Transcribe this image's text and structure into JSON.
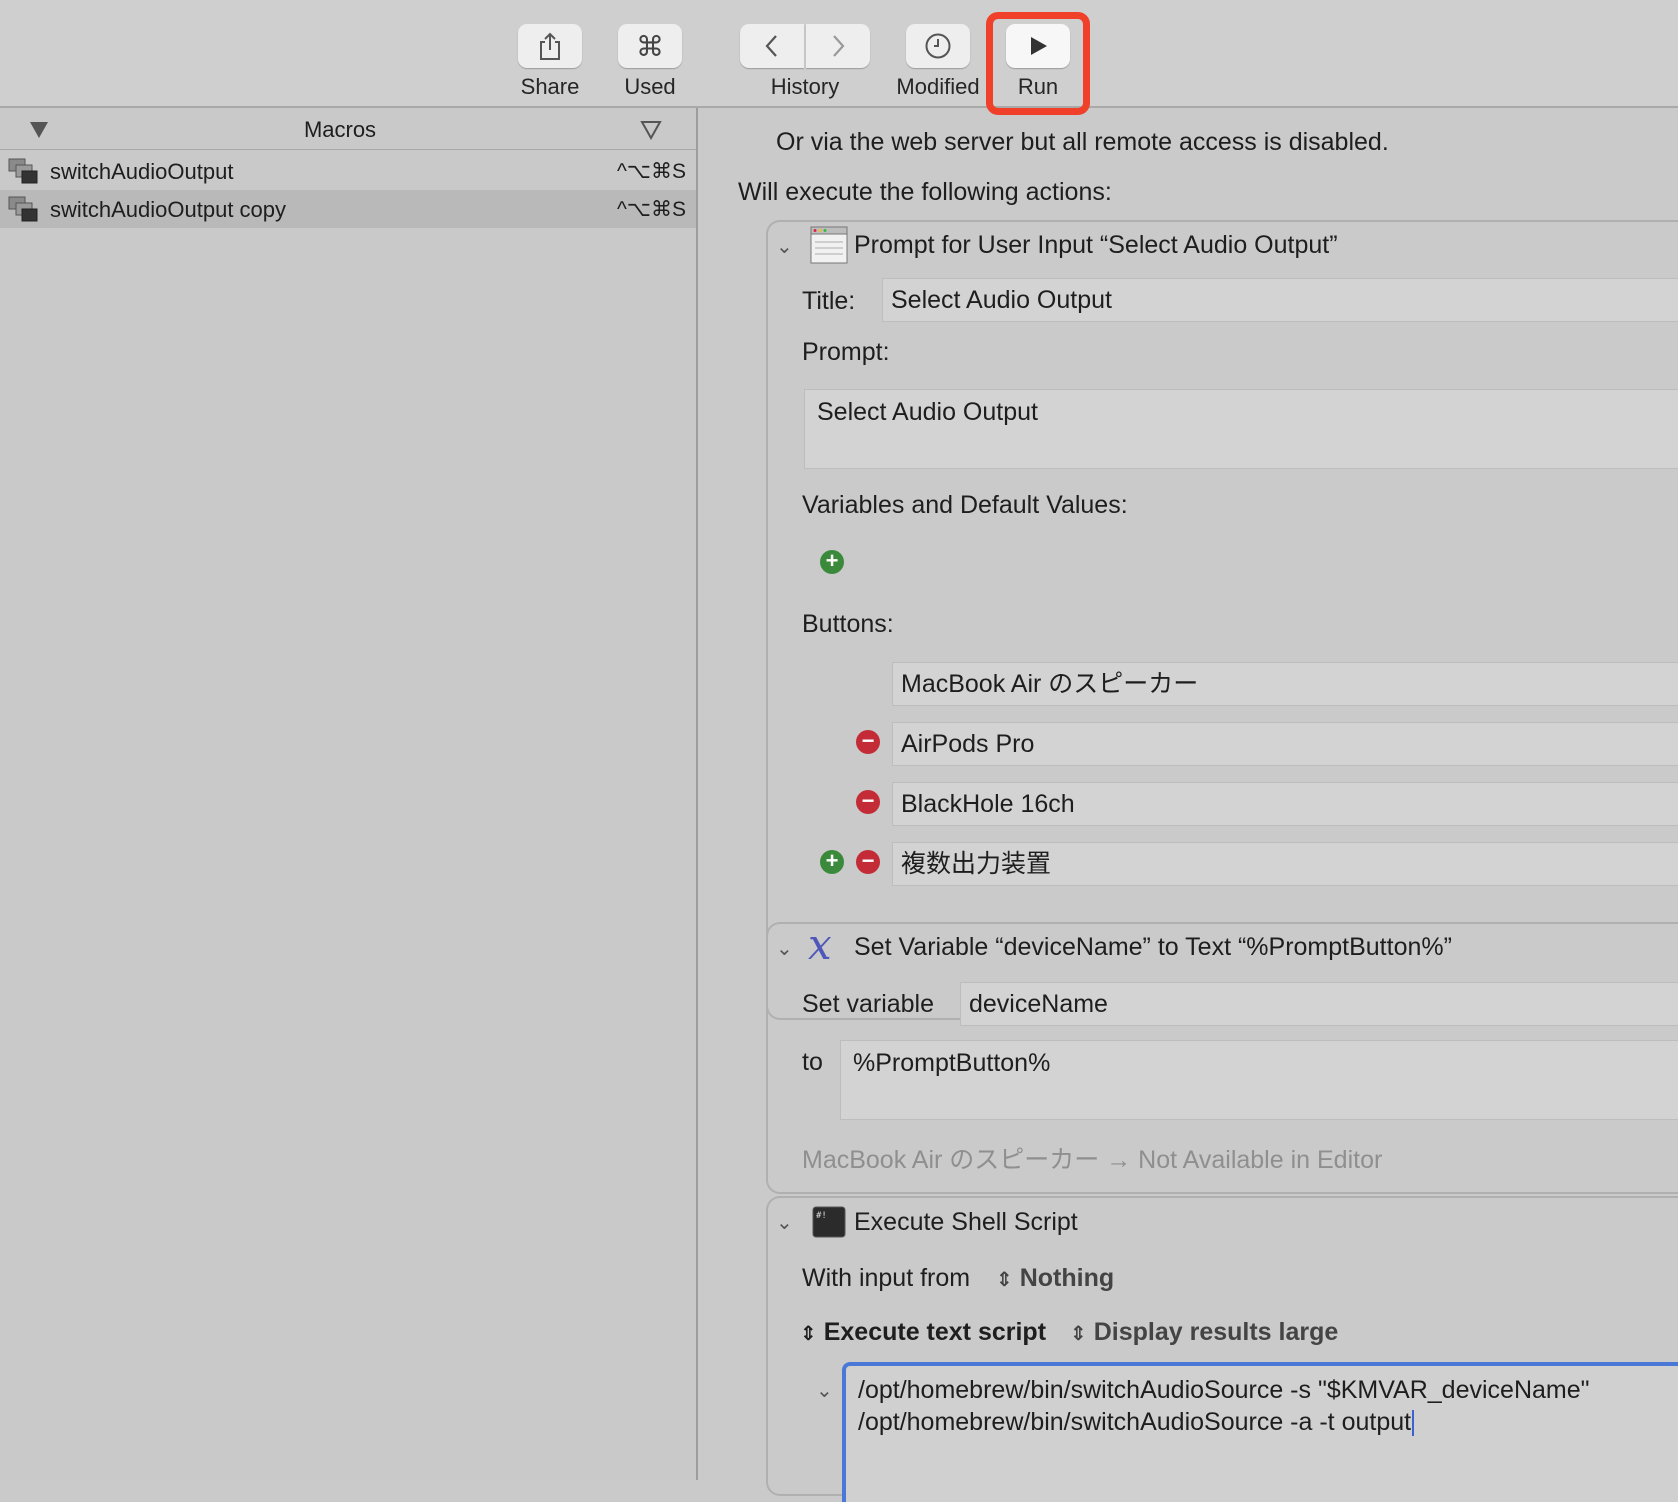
{
  "toolbar": {
    "share": "Share",
    "used": "Used",
    "history": "History",
    "modified": "Modified",
    "run": "Run"
  },
  "sidebar": {
    "header": "Macros",
    "macros": [
      {
        "name": "switchAudioOutput",
        "shortcut": "^⌥⌘S"
      },
      {
        "name": "switchAudioOutput copy",
        "shortcut": "^⌥⌘S"
      }
    ]
  },
  "content": {
    "remote_text": "Or via the web server but all remote access is disabled.",
    "execute_text": "Will execute the following actions:",
    "prompt_action": {
      "title": "Prompt for User Input “Select Audio Output”",
      "title_label": "Title:",
      "title_value": "Select Audio Output",
      "prompt_label": "Prompt:",
      "prompt_value": "Select Audio Output",
      "vars_label": "Variables and Default Values:",
      "buttons_label": "Buttons:",
      "buttons": [
        "MacBook Air のスピーカー",
        "AirPods Pro",
        "BlackHole 16ch",
        "複数出力装置"
      ]
    },
    "setvar_action": {
      "title": "Set Variable “deviceName” to Text “%PromptButton%”",
      "set_label": "Set variable",
      "var_name": "deviceName",
      "to_label": "to",
      "to_value": "%PromptButton%",
      "preview": "MacBook Air のスピーカー → Not Available in Editor"
    },
    "shell_action": {
      "title": "Execute Shell Script",
      "input_label": "With input from",
      "input_value": "Nothing",
      "mode": "Execute text script",
      "display": "Display results large",
      "script_lines": [
        "/opt/homebrew/bin/switchAudioSource -s \"$KMVAR_deviceName\"",
        "/opt/homebrew/bin/switchAudioSource -a -t output"
      ]
    }
  },
  "colors": {
    "run_highlight": "#f0402a",
    "add_green": "#3b8a3b",
    "remove_red": "#c32b36",
    "focus_blue": "#4a78d6"
  },
  "icons": [
    "share-icon",
    "command-icon",
    "back-icon",
    "forward-icon",
    "clock-icon",
    "play-icon",
    "prompt-window-icon",
    "variable-x-icon",
    "terminal-icon"
  ]
}
